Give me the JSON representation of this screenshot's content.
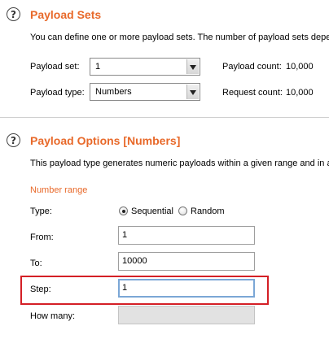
{
  "payload_sets": {
    "title": "Payload Sets",
    "description": "You can define one or more payload sets. The number of payload sets depe",
    "payload_set_label": "Payload set:",
    "payload_set_value": "1",
    "payload_type_label": "Payload type:",
    "payload_type_value": "Numbers",
    "payload_count_label": "Payload count:",
    "payload_count_value": "10,000",
    "request_count_label": "Request count:",
    "request_count_value": "10,000"
  },
  "payload_options": {
    "title": "Payload Options [Numbers]",
    "description": "This payload type generates numeric payloads within a given range and in a",
    "number_range_label": "Number range",
    "type_label": "Type:",
    "type_options": [
      {
        "label": "Sequential",
        "checked": true
      },
      {
        "label": "Random",
        "checked": false
      }
    ],
    "from_label": "From:",
    "from_value": "1",
    "to_label": "To:",
    "to_value": "10000",
    "step_label": "Step:",
    "step_value": "1",
    "how_many_label": "How many:",
    "how_many_value": ""
  },
  "icons": {
    "help": "?"
  },
  "colors": {
    "section_title": "#e8692a",
    "highlight_border": "#d41f26",
    "focus_border": "#7ba7d6"
  }
}
